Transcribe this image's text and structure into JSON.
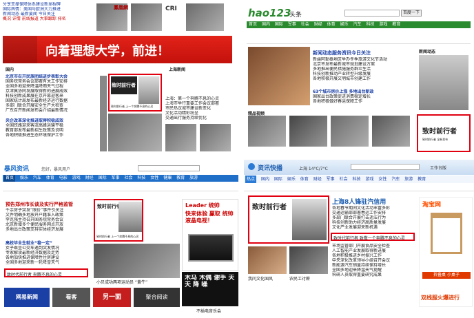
{
  "q1": {
    "top_lines": [
      "分享支撑保障体系建设新里程碑",
      "国际舆情：美国与欧洲大力推进",
      "新闻动态 最新要闻 今日关注"
    ],
    "top_red": "概况  详情 前线报道  大事跟踪  排名",
    "sites": [
      "鳳凰網",
      "CRI"
    ],
    "banner": "向着理想大学，前进！",
    "section_left": "国内",
    "section_right": "上海新闻",
    "news": [
      "北京市召开民族团结进步表彰大会",
      "国务院常务会议部署有关工作安排",
      "全国多地迎来降温降雨天气过程",
      "京津冀协同发展取得新的进展成效",
      "科技创新成果展在京开幕迎客来",
      "国家统计局发布最新经济运行数据",
      "多部门联合开展安全生产大检查",
      "广东召开新闻发布会介绍最新情况"
    ],
    "news2": [
      "央企改革深化推进取得积极成效",
      "全国铁路迎来客流高峰运输平稳",
      "教育部发布最新招生政策及说明",
      "各地积极推进生态环境保护工作"
    ],
    "ad_title": "致时前行者",
    "ad_caption": "致时前行者 上一个奔腾不息的心灵",
    "right_news": [
      "上海：第一个奔腾不息的心灵",
      "上海市举行重要工作会议部署",
      "市民热议城市建设新变化",
      "文化活动精彩纷呈",
      "交通出行服务持续优化"
    ]
  },
  "q2": {
    "logo": "hao123",
    "logo_tag": "头条",
    "search_btn": "百度一下",
    "nav": [
      "首页",
      "国内",
      "国际",
      "军事",
      "社会",
      "财经",
      "体育",
      "娱乐",
      "汽车",
      "科技",
      "游戏",
      "教育"
    ],
    "headline": "新闻动态服务资讯今日关注",
    "news": [
      "新疆阿勒泰地区举办冬季旅游文化节活动",
      "北京市发布最新城市规划建设方案",
      "多地推出便民措施服务群众生活",
      "科技创新推动产业转型升级发展",
      "各地积极开展文明城市创建工作"
    ],
    "headline2": "63个城市房价上涨 多地出台新政",
    "news2": [
      "国家出台政策促进消费稳定增长",
      "各地积极做好春运保障工作"
    ],
    "img_label": "精品视频",
    "side_title": "新闻动态",
    "side_ad_label": "致时前行者",
    "side_ad_small": "致时前行者 全新发布"
  },
  "q3": {
    "logo": "暴风资讯",
    "top_info": "您好，暴风用户",
    "nav": [
      "首页",
      "娱乐",
      "汽车",
      "体育",
      "电影",
      "游戏",
      "财经",
      "国际",
      "军事",
      "社会",
      "科技",
      "女性",
      "健康",
      "教育",
      "旅游"
    ],
    "headline": "预告郑州市长谈及实行严格监管",
    "news": [
      "千余房子突发“限价”事件引关注",
      "文件明确多地放开户籍准入政策",
      "李克强主持召开国务院常务会议",
      "北京新增多个便民服务网点开放",
      "多地出台政策支持实体经济发展"
    ],
    "headline2": "高校毕业生就业“稳一定”",
    "news2": [
      "女子乘坐公交车遇到突发情况",
      "专家解读最新经济数据及走势",
      "各地加快推进保障性住房建设",
      "全国多地迎来新一轮降雪天气"
    ],
    "hl_news": "致时代前行者 奔腾不息的心灵",
    "ad_title": "致时前行者",
    "ad_caption": "致时前行者 上一个奔腾不息的心灵",
    "leader_brand": "Leader 统帅",
    "leader_text": "快来体验 赢取 统帅液晶电视！",
    "bottom_center": "小贝成功两项运动员 “黄牛”",
    "bottom_right": "不插电音乐会",
    "poster_text": "木马 木偶 谢手 天天 降 噪",
    "footer": [
      "网易新闻",
      "看客",
      "另一面",
      "聚合阅读"
    ]
  },
  "q4": {
    "title": "资讯快播",
    "location": "上海 14°C/7°C",
    "tab_label": "工作台版",
    "nav": [
      "热点",
      "国内",
      "国际",
      "娱乐",
      "体育",
      "财经",
      "军事",
      "社会",
      "科技",
      "游戏",
      "女性",
      "汽车",
      "旅游",
      "教育"
    ],
    "headline": "上海8人锋驻汽信用",
    "news": [
      "各地春节期间文化活动丰富多彩",
      "交通运输部部署春运工作安排",
      "多部门联合开展打击违法行为",
      "科技创新助力经济高质量发展",
      "文化产业发展迎来新机遇"
    ],
    "ad_title": "致时前行者",
    "hl_news": "致时代前行者 致敬一个奔腾不息的心灵",
    "news2": [
      "市场监管部门开展食品安全检查",
      "人工智能产业发展取得新进展",
      "各地积极推进乡村振兴工作",
      "中央深化改革领导小组召开会议",
      "新能源汽车销量持续保持增长",
      "全国多地迎来降温天气提醒",
      "科研人员取得重要研究成果"
    ],
    "thumb_labels": [
      "我问文化国风",
      "农民工讨薪"
    ],
    "taobao": "淘宝网",
    "table_label": "折叠桌 小桌子",
    "side_ad": "双线服火爆进行"
  },
  "colors": {
    "red_highlight": "#e00010",
    "hao_green": "#2a8a2e",
    "baofeng_blue": "#1f6fc9",
    "news_red": "#c00000"
  }
}
